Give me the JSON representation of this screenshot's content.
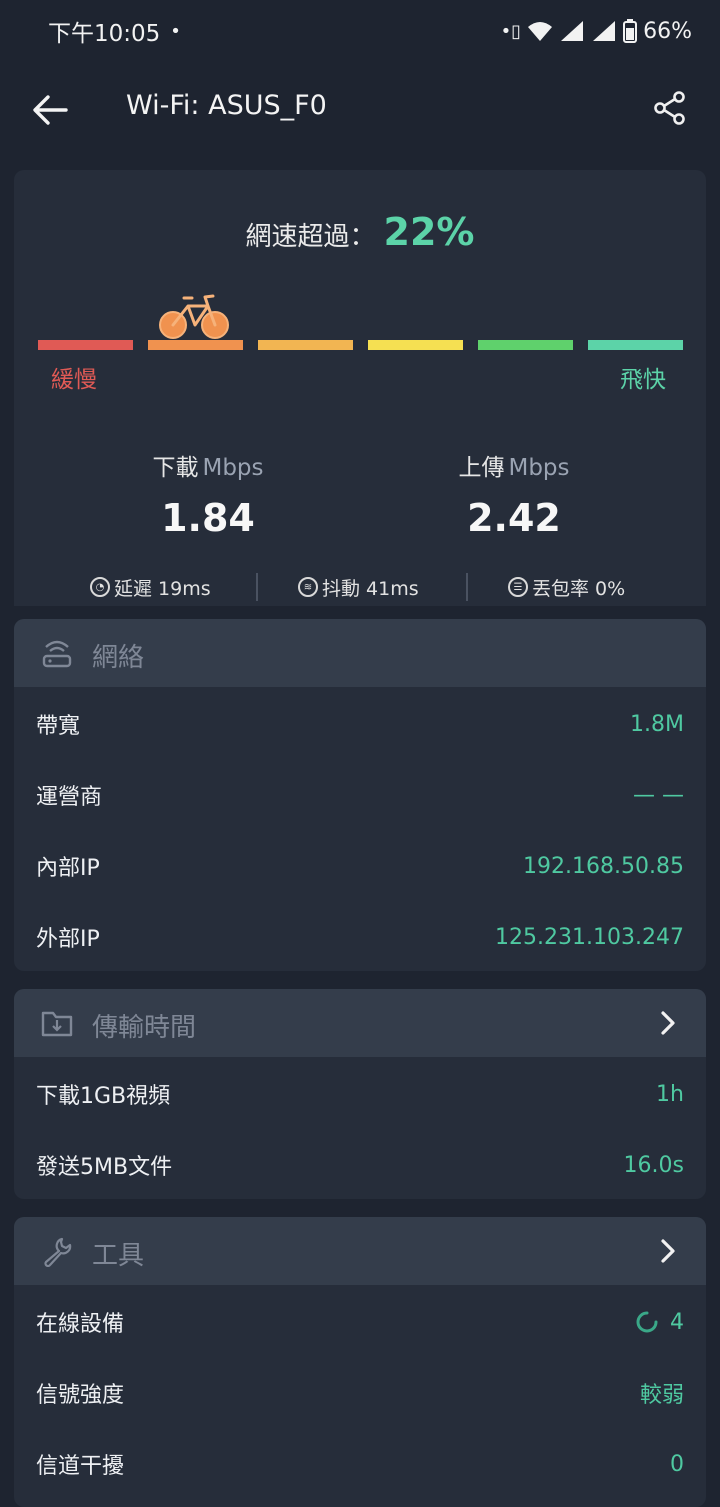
{
  "status_bar": {
    "time": "下午10:05",
    "dot": "•",
    "battery": "66%"
  },
  "app_bar": {
    "title": "Wi-Fi: ASUS_F0",
    "back_icon": "arrow-left-icon",
    "share_icon": "share-icon"
  },
  "speed": {
    "headline_label": "網速超過：",
    "headline_percent": "22%",
    "level_segments": [
      "#e05a55",
      "#f0924f",
      "#f2b552",
      "#f5e052",
      "#5fd16c",
      "#5cd3a8"
    ],
    "current_level_index": 1,
    "slow_label": "緩慢",
    "fast_label": "飛快",
    "download_label": "下載",
    "download_unit": "Mbps",
    "download_value": "1.84",
    "upload_label": "上傳",
    "upload_unit": "Mbps",
    "upload_value": "2.42",
    "latency": "延遲 19ms",
    "jitter": "抖動 41ms",
    "packet_loss": "丟包率 0%"
  },
  "network": {
    "title": "網絡",
    "rows": [
      {
        "label": "帶寬",
        "value": "1.8M"
      },
      {
        "label": "運營商",
        "value": "— —"
      },
      {
        "label": "內部IP",
        "value": "192.168.50.85"
      },
      {
        "label": "外部IP",
        "value": "125.231.103.247"
      }
    ]
  },
  "transfer": {
    "title": "傳輸時間",
    "rows": [
      {
        "label": "下載1GB視頻",
        "value": "1h"
      },
      {
        "label": "發送5MB文件",
        "value": "16.0s"
      }
    ]
  },
  "tools": {
    "title": "工具",
    "rows": [
      {
        "label": "在線設備",
        "value": "4"
      },
      {
        "label": "信號強度",
        "value": "較弱"
      },
      {
        "label": "信道干擾",
        "value": "0"
      }
    ]
  },
  "colors": {
    "accent": "#5cd3a8",
    "background": "#1e2430",
    "card": "#262d3a",
    "section_header": "#343d4b"
  }
}
